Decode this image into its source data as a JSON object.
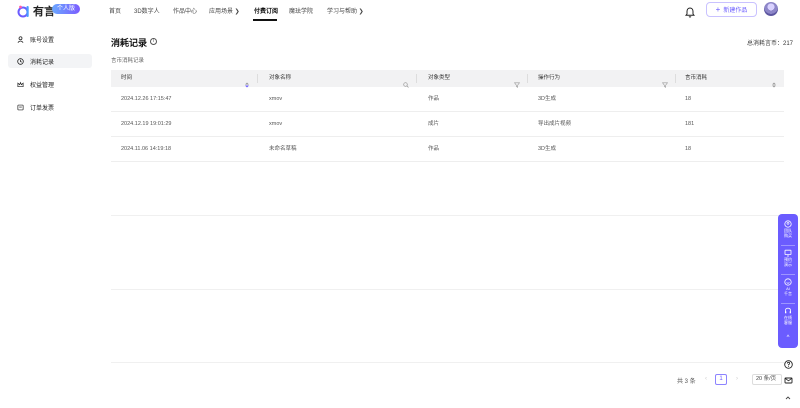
{
  "brand": {
    "name": "有言",
    "badge": "个人版"
  },
  "nav": {
    "items": [
      {
        "label": "首页"
      },
      {
        "label": "3D数字人"
      },
      {
        "label": "作品中心"
      },
      {
        "label": "应用场景 ❯"
      },
      {
        "label": "付费订阅"
      },
      {
        "label": "魔珐学院"
      },
      {
        "label": "学习与帮助 ❯"
      }
    ],
    "active_label": "付费订阅"
  },
  "header": {
    "new_work_label": "新建作品",
    "new_work_plus": "+"
  },
  "sidebar": {
    "items": [
      {
        "label": "账号设置"
      },
      {
        "label": "消耗记录"
      },
      {
        "label": "权益管理"
      },
      {
        "label": "订单发票"
      }
    ],
    "active": "消耗记录"
  },
  "main": {
    "title": "消耗记录",
    "info_glyph": "i",
    "total_label": "总消耗言币：217",
    "subtitle": "言币消耗记录"
  },
  "table": {
    "columns": [
      "时间",
      "对象名称",
      "对象类型",
      "操作行为",
      "言币消耗"
    ],
    "rows": [
      {
        "time": "2024.12.26 17:15:47",
        "name": "xmov",
        "type": "作品",
        "action": "3D生成",
        "cost": "18"
      },
      {
        "time": "2024.12.19 19:01:29",
        "name": "xmov",
        "type": "成片",
        "action": "导出成片视频",
        "cost": "181"
      },
      {
        "time": "2024.11.06 14:19:18",
        "name": "未命名草稿",
        "type": "作品",
        "action": "3D生成",
        "cost": "18"
      }
    ]
  },
  "pagination": {
    "total_label": "共 3 条",
    "prev": "‹",
    "current_page": "1",
    "next": "›",
    "page_size": "20 条/页"
  },
  "float_bar": {
    "items": [
      {
        "label_line1": "团队",
        "label_line2": "购买"
      },
      {
        "label_line1": "预约",
        "label_line2": "演示"
      },
      {
        "label_line1": "AI",
        "label_line2": "千言"
      },
      {
        "label_line1": "在线",
        "label_line2": "客服"
      }
    ],
    "collapse_glyph": "^"
  },
  "colors": {
    "accent": "#6b5cff",
    "table_header": "#f2f2f3"
  }
}
